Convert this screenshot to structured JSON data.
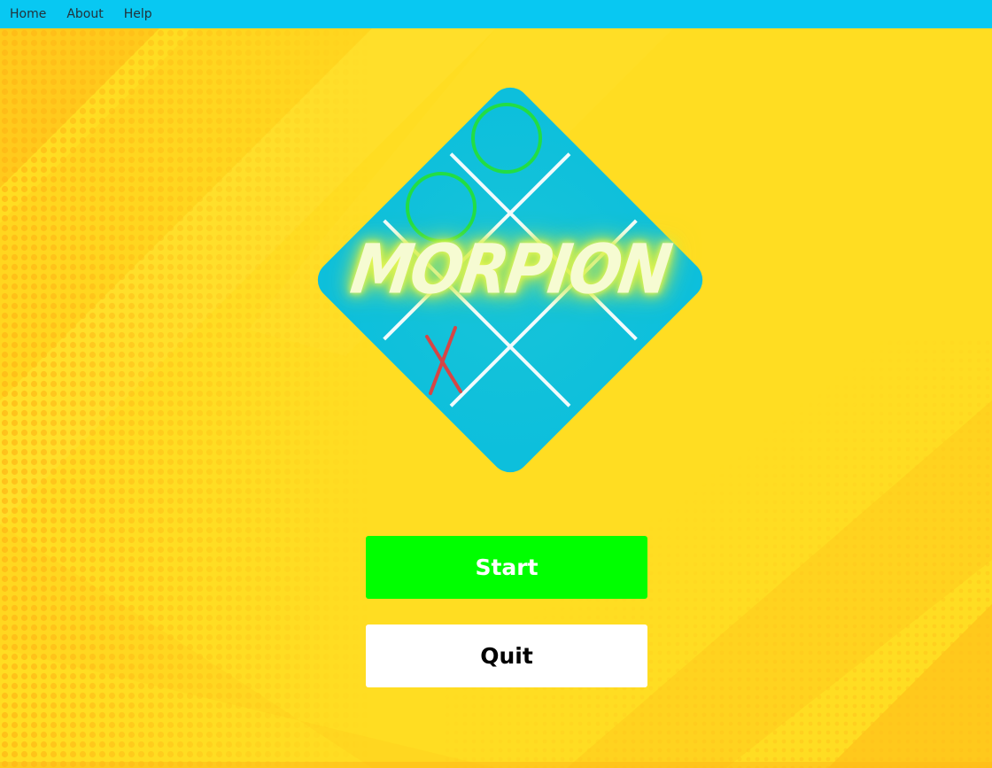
{
  "menu": {
    "items": [
      {
        "label": "Home"
      },
      {
        "label": "About"
      },
      {
        "label": "Help"
      }
    ]
  },
  "logo": {
    "title": "MORPION",
    "board_cells": [
      [
        "O",
        "",
        ""
      ],
      [
        "O",
        "",
        ""
      ],
      [
        "X",
        "",
        ""
      ]
    ]
  },
  "buttons": {
    "start_label": "Start",
    "quit_label": "Quit"
  },
  "colors": {
    "menubar": "#08C8F2",
    "background": "#FFDD22",
    "board": "#10C0DA",
    "start_button": "#00FF00",
    "quit_button": "#FFFFFF",
    "o_mark": "#22DD44",
    "x_mark": "#D64545"
  }
}
